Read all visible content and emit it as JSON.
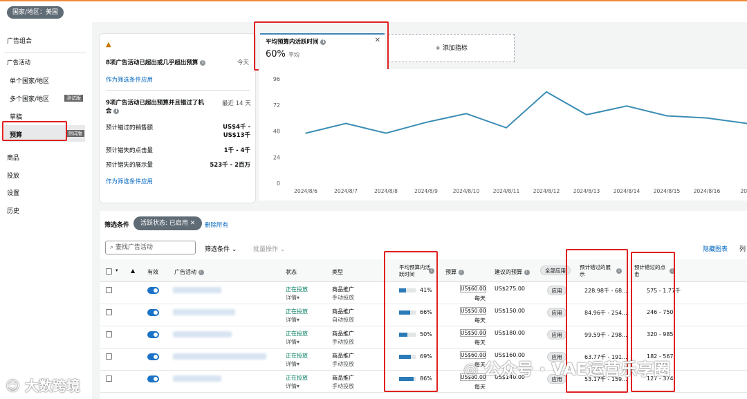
{
  "topbar": {
    "country_label": "国家/地区：美国"
  },
  "sidebar": {
    "portfolio": "广告组合",
    "campaigns_header": "广告活动",
    "single_country": "单个国家/地区",
    "multi_country": "多个国家/地区",
    "multi_tag": "测试版",
    "drafts": "草稿",
    "budget": "预算",
    "budget_tag": "测试版",
    "products": "商品",
    "placements": "投放",
    "settings": "设置",
    "history": "历史"
  },
  "alerts": {
    "warning_icon": "warning-icon",
    "alert1_title": "8项广告活动已超出或几乎超出预算",
    "alert1_time": "今天",
    "alert1_link": "作为筛选条件应用",
    "alert2_title": "9项广告活动已超出预算并且错过了机会",
    "alert2_time": "最近 14 天",
    "rows": [
      {
        "label": "预计错过的销售额",
        "value": "US$4千 - US$13千"
      },
      {
        "label": "预计错失的点击量",
        "value": "1千 - 4千"
      },
      {
        "label": "预计错失的展示量",
        "value": "523千 - 2百万"
      }
    ],
    "alert2_link": "作为筛选条件应用"
  },
  "metric": {
    "label": "平均预算内活跃时间",
    "value": "60%",
    "sub": "平均",
    "add_label": "+ 添加指标"
  },
  "chart_data": {
    "type": "line",
    "x": [
      "2024/8/6",
      "2024/8/7",
      "2024/8/8",
      "2024/8/9",
      "2024/8/10",
      "2024/8/11",
      "2024/8/12",
      "2024/8/13",
      "2024/8/14",
      "2024/8/15",
      "2024/8/16",
      "2024"
    ],
    "series": [
      {
        "values": [
          46,
          55,
          46,
          56,
          64,
          51,
          84,
          63,
          71,
          62,
          60,
          55
        ],
        "color": "#3b8db5"
      }
    ],
    "yticks": [
      0,
      24,
      48,
      72,
      96
    ],
    "ylim": [
      0,
      96
    ]
  },
  "filters": {
    "label": "筛选条件",
    "chip": "活跃状态: 已启用",
    "delete_all": "删除所有"
  },
  "toolbar": {
    "search_placeholder": "查找广告活动",
    "filter_btn": "筛选条件",
    "bulk_btn": "批量操作",
    "hide_chart": "隐藏图表",
    "columns": "列"
  },
  "table": {
    "headers": {
      "active": "有效",
      "campaign": "广告活动",
      "status": "状态",
      "type": "类型",
      "avg_time": "平均预算内活跃时间",
      "budget": "预算",
      "suggested": "建议的预算",
      "apply_all": "全部应用",
      "impr": "预计错过的展示",
      "clicks": "预计错过的点击"
    },
    "rows": [
      {
        "status": "正在投放",
        "detail": "详情",
        "type1": "商品推广",
        "type2": "手动投放",
        "pct": "41%",
        "pct_val": 41,
        "budget": "US$60.00",
        "per": "每天",
        "suggested": "US$275.00",
        "apply": "应用",
        "impr": "228.98千 - 68...",
        "clicks": "575 - 1.77千"
      },
      {
        "status": "正在投放",
        "detail": "详情",
        "type1": "商品推广",
        "type2": "自动投放",
        "pct": "66%",
        "pct_val": 66,
        "budget": "US$50.00",
        "per": "每天",
        "suggested": "US$150.00",
        "apply": "应用",
        "impr": "84.96千 - 254...",
        "clicks": "246 - 750"
      },
      {
        "status": "正在投放",
        "detail": "详情",
        "type1": "商品推广",
        "type2": "手动投放",
        "pct": "50%",
        "pct_val": 50,
        "budget": "US$50.00",
        "per": "每天",
        "suggested": "US$180.00",
        "apply": "应用",
        "impr": "99.59千 - 298...",
        "clicks": "320 - 985"
      },
      {
        "status": "正在投放",
        "detail": "详情",
        "type1": "商品推广",
        "type2": "手动投放",
        "pct": "69%",
        "pct_val": 69,
        "budget": "US$60.00",
        "per": "每天",
        "suggested": "US$160.00",
        "apply": "应用",
        "impr": "63.77千 - 191...",
        "clicks": "182 - 567"
      },
      {
        "status": "正在投放",
        "detail": "详情",
        "type1": "商品推广",
        "type2": "手动投放",
        "pct": "86%",
        "pct_val": 86,
        "budget": "US$60.00",
        "per": "每天",
        "suggested": "US$140.00",
        "apply": "应用",
        "impr": "53.17千 - 159...",
        "clicks": "127 - 374"
      }
    ]
  },
  "watermarks": {
    "left": "大数跨境",
    "right": "公众号 · VAE运营乐享圈"
  }
}
